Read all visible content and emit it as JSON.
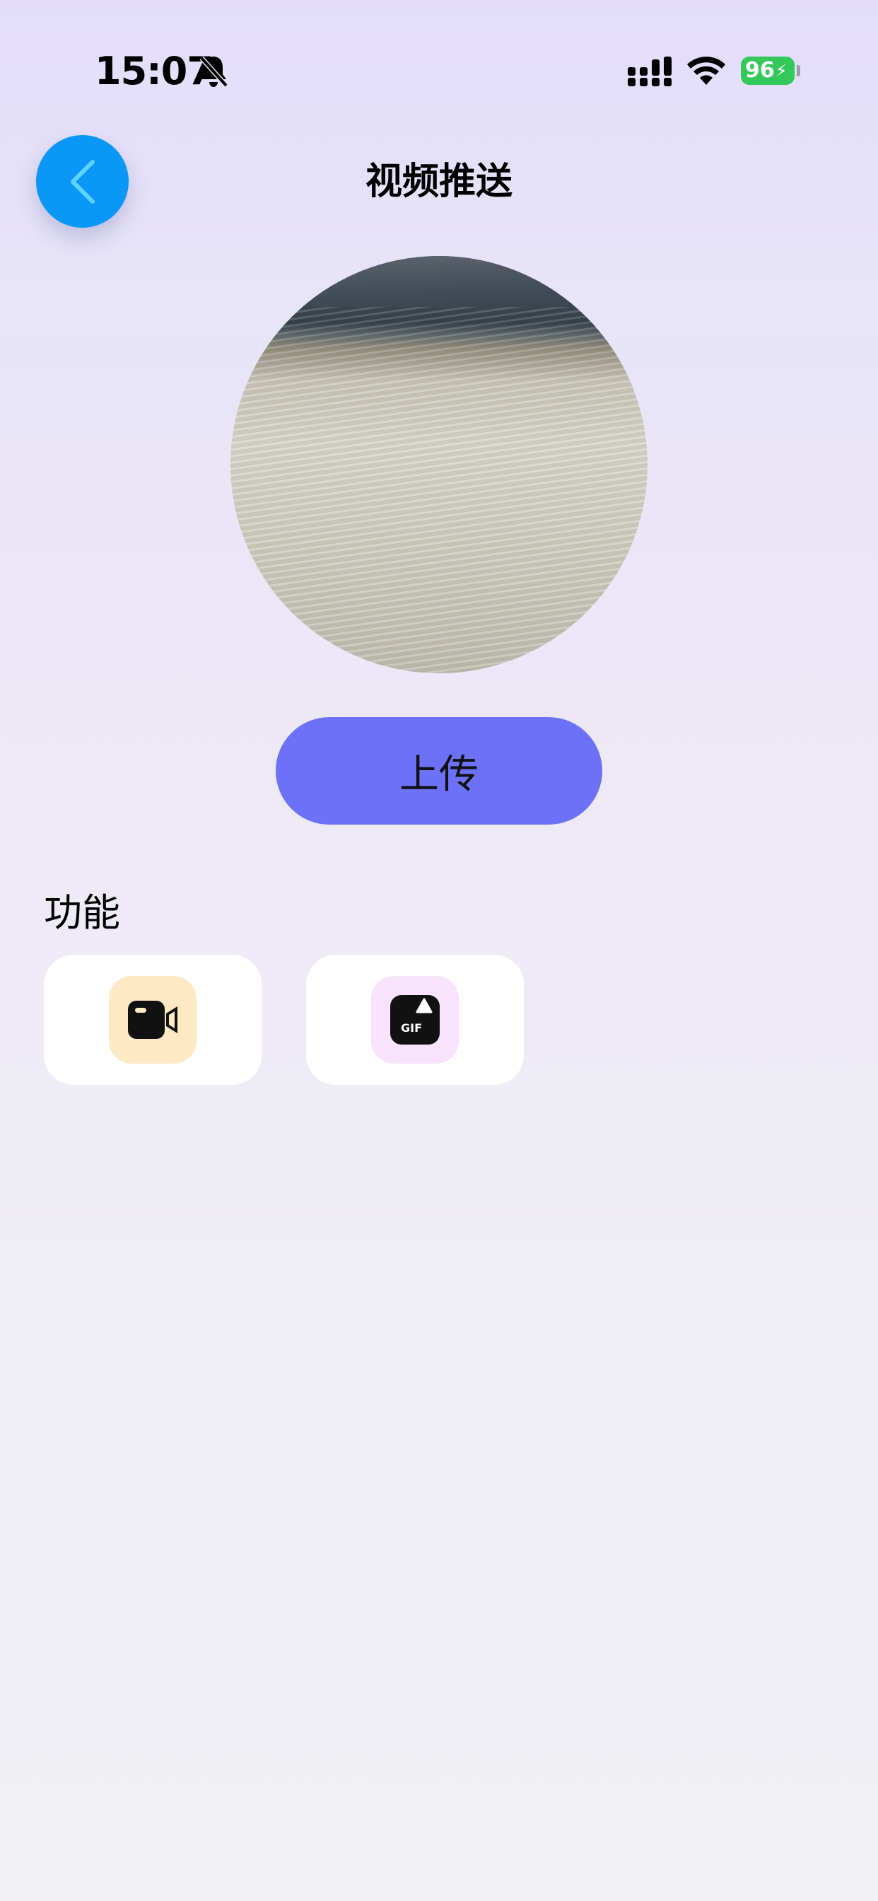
{
  "status_bar": {
    "time": "15:07",
    "battery_level": "96"
  },
  "header": {
    "title": "视频推送"
  },
  "main": {
    "upload_label": "上传"
  },
  "functions": {
    "section_title": "功能",
    "items": [
      {
        "icon": "video-camera-icon",
        "icon_bg": "#fde9c3"
      },
      {
        "icon": "gif-icon",
        "icon_bg": "#f7e3fb"
      }
    ]
  },
  "colors": {
    "back_button": "#0a97f7",
    "upload_button": "#6c72f7",
    "battery": "#34c759"
  }
}
